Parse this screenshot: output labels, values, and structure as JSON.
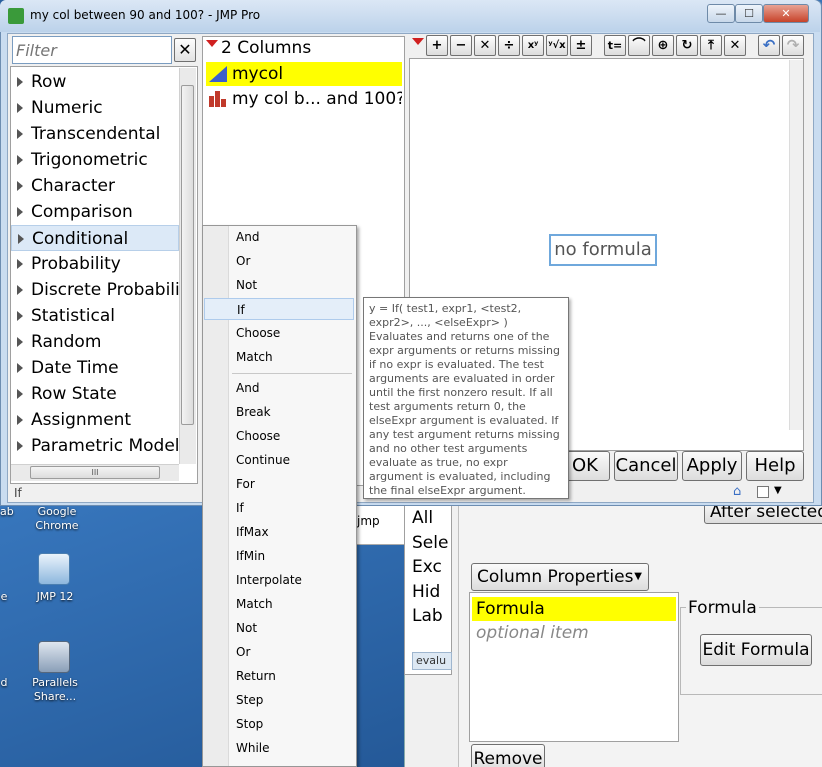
{
  "window": {
    "title": "my col between 90 and 100? - JMP Pro",
    "controls": {
      "minimize": "—",
      "maximize": "☐",
      "close": "✕"
    }
  },
  "functions": {
    "filter_placeholder": "Filter",
    "clear_label": "✕",
    "categories": [
      "Row",
      "Numeric",
      "Transcendental",
      "Trigonometric",
      "Character",
      "Comparison",
      "Conditional",
      "Probability",
      "Discrete Probabili",
      "Statistical",
      "Random",
      "Date Time",
      "Row State",
      "Assignment",
      "Parametric Model"
    ],
    "selected": "Conditional",
    "hscroll_grip": "III",
    "status": "If"
  },
  "columns": {
    "header": "2 Columns",
    "items": [
      {
        "name": "mycol",
        "icon": "continuous-icon",
        "selected": true
      },
      {
        "name": "my col b... and 100?",
        "icon": "nominal-bar-icon",
        "selected": false
      }
    ]
  },
  "formula_toolbar": {
    "buttons": [
      "+",
      "−",
      "✕",
      "÷",
      "xʸ",
      "ʸ√x",
      "±",
      "t=",
      "⌒",
      "⊕",
      "↻",
      "⤒",
      "✕"
    ],
    "undo": "↶",
    "redo": "↷"
  },
  "formula": {
    "placeholder": "no formula"
  },
  "dialog_buttons": {
    "ok": "OK",
    "cancel": "Cancel",
    "apply": "Apply",
    "help": "Help"
  },
  "menu": {
    "group1": [
      "And",
      "Or",
      "Not",
      "If",
      "Choose",
      "Match"
    ],
    "group2": [
      "And",
      "Break",
      "Choose",
      "Continue",
      "For",
      "If",
      "IfMax",
      "IfMin",
      "Interpolate",
      "Match",
      "Not",
      "Or",
      "Return",
      "Step",
      "Stop",
      "While"
    ],
    "highlighted": "If"
  },
  "tooltip": {
    "signature": "y = If( test1, expr1, <test2, expr2>, ..., <elseExpr> )",
    "description": "Evaluates and returns one of the expr arguments or returns missing if no expr is evaluated. The test arguments are evaluated in order until the first nonzero result. If all test arguments return 0, the elseExpr argument is evaluated. If any test argument returns missing and no other test arguments evaluate as true, no expr argument is evaluated, including the final elseExpr argument."
  },
  "background_dialog": {
    "after_selected": "After selected",
    "side_labels": [
      "All",
      "Sele",
      "Exc",
      "Hid",
      "Lab"
    ],
    "column_properties_label": "Column Properties",
    "properties": [
      {
        "label": "Formula",
        "selected": true
      },
      {
        "label": "optional item",
        "selected": false
      }
    ],
    "group_label": "Formula",
    "edit_formula": "Edit Formula",
    "remove": "Remove",
    "eval_tab": "evalu",
    "jmp_snip": "jmp"
  },
  "desktop": {
    "icons": [
      {
        "label": "Google Chrome"
      },
      {
        "label": "JMP 12"
      },
      {
        "label": "Parallels Share..."
      }
    ],
    "edge_labels": [
      "ab",
      "e",
      "d"
    ]
  }
}
